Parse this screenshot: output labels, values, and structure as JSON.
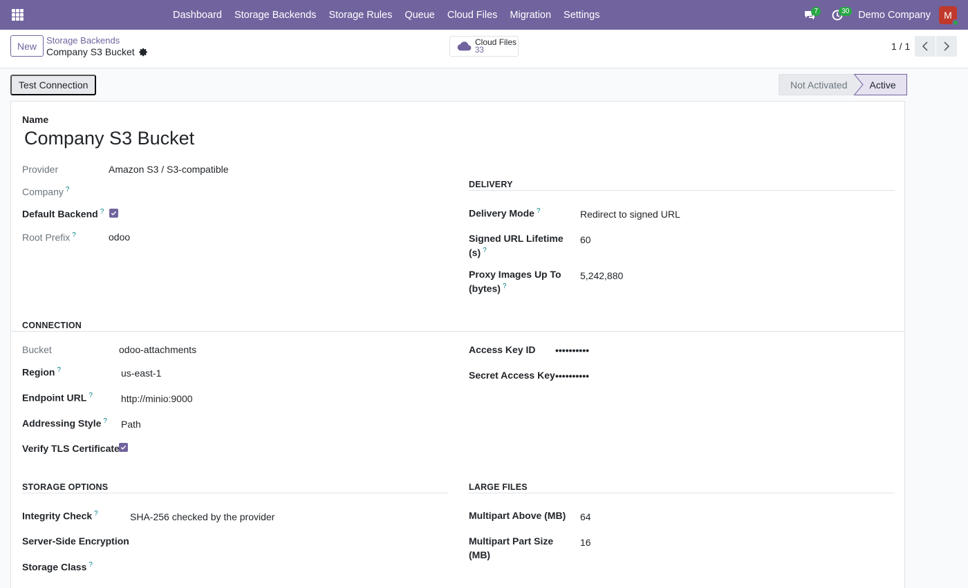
{
  "nav": {
    "menu": [
      "Dashboard",
      "Storage Backends",
      "Storage Rules",
      "Queue",
      "Cloud Files",
      "Migration",
      "Settings"
    ],
    "messages_count": "7",
    "activities_count": "30",
    "company": "Demo Company",
    "avatar_initial": "M",
    "accent_color": "#71639e"
  },
  "control": {
    "new_label": "New",
    "breadcrumb_parent": "Storage Backends",
    "breadcrumb_current": "Company S3 Bucket",
    "smart_button_label": "Cloud Files",
    "smart_button_count": "33",
    "pager": "1 / 1"
  },
  "status": {
    "test_connection_label": "Test Connection",
    "states": [
      "Not Activated",
      "Active"
    ],
    "current": "Active"
  },
  "form": {
    "name_label": "Name",
    "name_value": "Company S3 Bucket",
    "provider_label": "Provider",
    "provider_value": "Amazon S3 / S3-compatible",
    "company_label": "Company",
    "default_backend_label": "Default Backend",
    "default_backend_checked": true,
    "root_prefix_label": "Root Prefix",
    "root_prefix_value": "odoo",
    "delivery": {
      "title": "DELIVERY",
      "mode_label": "Delivery Mode",
      "mode_value": "Redirect to signed URL",
      "lifetime_label_1": "Signed URL Lifetime",
      "lifetime_label_2": "(s)",
      "lifetime_value": "60",
      "proxy_label_1": "Proxy Images Up To",
      "proxy_label_2": "(bytes)",
      "proxy_value": "5,242,880"
    },
    "connection": {
      "title": "CONNECTION",
      "bucket_label": "Bucket",
      "bucket_value": "odoo-attachments",
      "region_label": "Region",
      "region_value": "us-east-1",
      "endpoint_label": "Endpoint URL",
      "endpoint_value": "http://minio:9000",
      "addressing_label": "Addressing Style",
      "addressing_value": "Path",
      "verify_label": "Verify TLS Certificate",
      "verify_checked": true,
      "access_key_label": "Access Key ID",
      "access_key_value": "••••••••••",
      "secret_key_label": "Secret Access Key",
      "secret_key_value": "••••••••••"
    },
    "storage_options": {
      "title": "STORAGE OPTIONS",
      "integrity_label": "Integrity Check",
      "integrity_value": "SHA-256 checked by the provider",
      "sse_label": "Server-Side Encryption",
      "storage_class_label": "Storage Class"
    },
    "large_files": {
      "title": "LARGE FILES",
      "multipart_above_label": "Multipart Above (MB)",
      "multipart_above_value": "64",
      "part_size_label_1": "Multipart Part Size",
      "part_size_label_2": "(MB)",
      "part_size_value": "16"
    },
    "help_mark": "?"
  }
}
